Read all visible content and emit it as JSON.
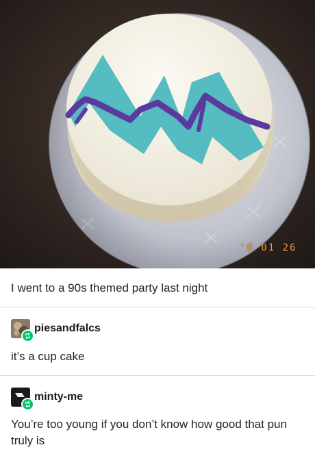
{
  "photo": {
    "date_stamp": "'8  01  26",
    "icon": "cake-photo"
  },
  "post": {
    "caption": "I went to a 90s themed party last night"
  },
  "reblogs": [
    {
      "username": "piesandfalcs",
      "text": "it’s a cup cake",
      "avatar_icon": "avatar-cat-icon"
    },
    {
      "username": "minty-me",
      "text": "You’re too young if you don’t know how good that pun truly is",
      "avatar_icon": "avatar-dark-icon"
    }
  ],
  "colors": {
    "reblog_badge": "#00c46a",
    "frosting_teal": "#4cb8bf",
    "frosting_purple": "#5b3aa0",
    "date_stamp": "#f0a23a"
  }
}
